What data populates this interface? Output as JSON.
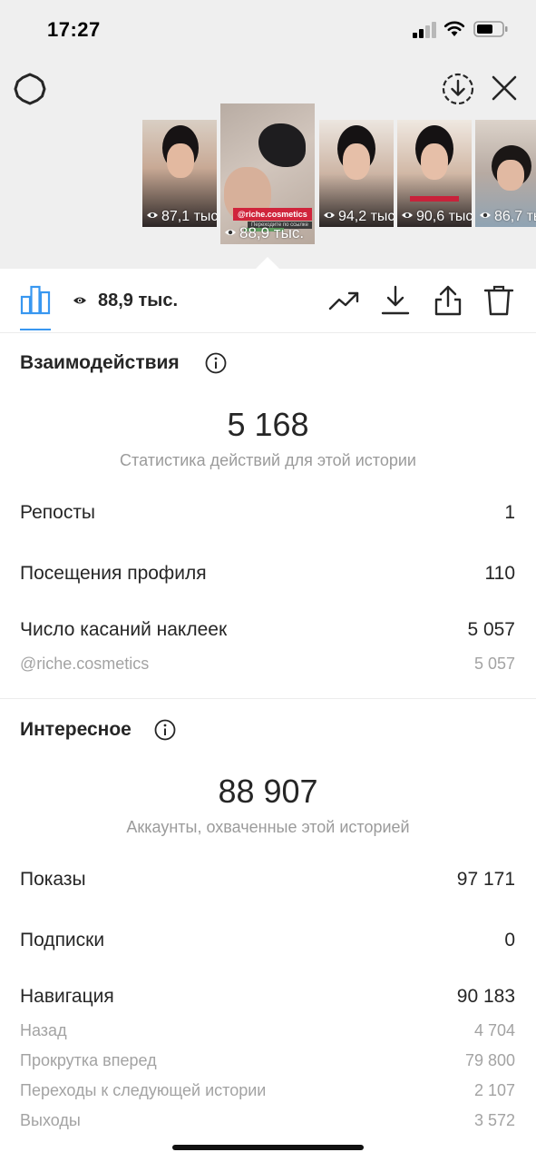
{
  "status_bar": {
    "time": "17:27"
  },
  "stories": [
    {
      "views": "87,1 тыс."
    },
    {
      "views": "88,9 тыс.",
      "tag": "@riche.cosmetics",
      "small_text": "Переходите по ссылке"
    },
    {
      "views": "94,2 тыс."
    },
    {
      "views": "90,6 тыс."
    },
    {
      "views": "86,7 тыс."
    }
  ],
  "toolbar": {
    "views": "88,9 тыс."
  },
  "interactions": {
    "title": "Взаимодействия",
    "total": "5 168",
    "caption": "Статистика действий для этой истории",
    "rows": [
      {
        "label": "Репосты",
        "value": "1"
      },
      {
        "label": "Посещения профиля",
        "value": "110"
      },
      {
        "label": "Число касаний наклеек",
        "value": "5 057"
      }
    ],
    "sub_rows": [
      {
        "label": "@riche.cosmetics",
        "value": "5 057"
      }
    ]
  },
  "discovery": {
    "title": "Интересное",
    "total": "88 907",
    "caption": "Аккаунты, охваченные этой историей",
    "rows": [
      {
        "label": "Показы",
        "value": "97 171"
      },
      {
        "label": "Подписки",
        "value": "0"
      },
      {
        "label": "Навигация",
        "value": "90 183"
      }
    ],
    "sub_rows": [
      {
        "label": "Назад",
        "value": "4 704"
      },
      {
        "label": "Прокрутка вперед",
        "value": "79 800"
      },
      {
        "label": "Переходы к следующей истории",
        "value": "2 107"
      },
      {
        "label": "Выходы",
        "value": "3 572"
      }
    ]
  },
  "colors": {
    "accent": "#3897f0",
    "tag_red": "#d0243b",
    "muted": "#9b9b9b"
  },
  "icons": [
    "settings-icon",
    "download-circle-icon",
    "close-icon",
    "bar-chart-icon",
    "eye-icon",
    "trending-icon",
    "download-icon",
    "share-icon",
    "trash-icon",
    "info-icon"
  ]
}
